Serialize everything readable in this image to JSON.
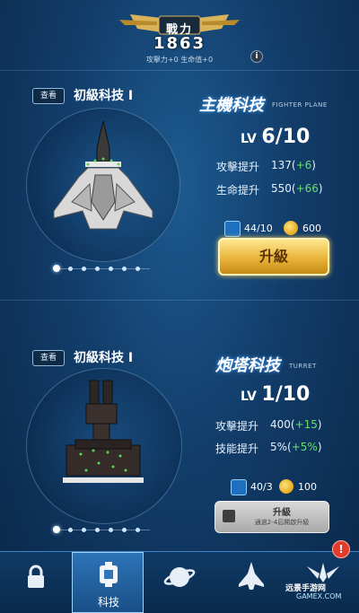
{
  "power": {
    "label": "戰力",
    "value": "1863",
    "sub": "攻擊力+0  生命值+0"
  },
  "info_icon": "i",
  "sections": [
    {
      "view_label": "查看",
      "tier": "初級科技 I",
      "title": "主機科技",
      "subtitle": "FIGHTER PLANE",
      "level_prefix": "LV",
      "level": "6/10",
      "stats": [
        {
          "label": "攻擊提升",
          "value": "137",
          "plus": "+6"
        },
        {
          "label": "生命提升",
          "value": "550",
          "plus": "+66"
        }
      ],
      "resource": "44/10",
      "cost": "600",
      "button": "升級"
    },
    {
      "view_label": "查看",
      "tier": "初級科技 I",
      "title": "炮塔科技",
      "subtitle": "TURRET",
      "level_prefix": "LV",
      "level": "1/10",
      "stats": [
        {
          "label": "攻擊提升",
          "value": "400",
          "plus": "+15"
        },
        {
          "label": "技能提升",
          "value": "5%",
          "plus": "+5%"
        }
      ],
      "resource": "40/3",
      "cost": "100",
      "button": "升級",
      "button_note": "通過2-4后開啟升級"
    }
  ],
  "nav": {
    "items": [
      {
        "icon": "lock-icon",
        "label": ""
      },
      {
        "icon": "tech-icon",
        "label": "科技"
      },
      {
        "icon": "planet-icon",
        "label": ""
      },
      {
        "icon": "jet-icon",
        "label": ""
      },
      {
        "icon": "wings-icon",
        "label": ""
      }
    ]
  },
  "alert": "!",
  "watermark": {
    "top": "远景手游网",
    "bottom": "GAMEX.COM"
  },
  "colors": {
    "accent_green": "#66e06a",
    "gold": "#e9b43a",
    "background": "#123d6a"
  }
}
